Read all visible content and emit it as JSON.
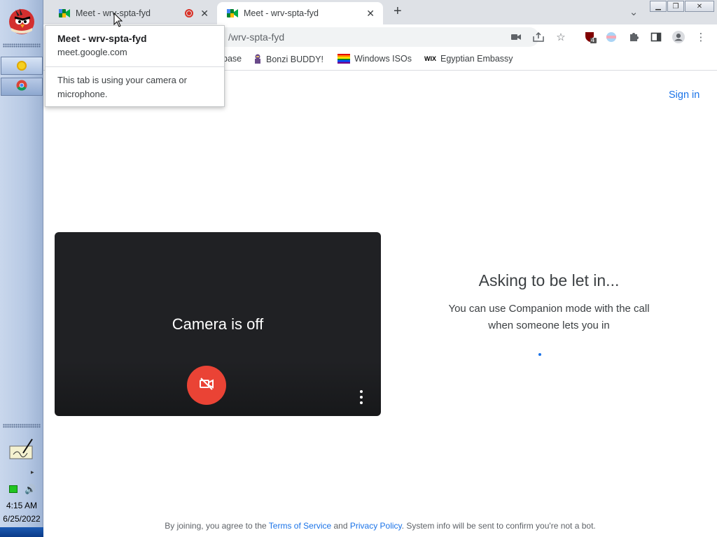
{
  "taskbar": {
    "time": "4:15 AM",
    "date": "6/25/2022"
  },
  "tabs": [
    {
      "title": "Meet - wrv-spta-fyd"
    },
    {
      "title": "Meet - wrv-spta-fyd"
    }
  ],
  "toolbar": {
    "url_visible": "/wrv-spta-fyd",
    "extension_badge": "4"
  },
  "bookmarks": [
    {
      "label": "base"
    },
    {
      "label": "Bonzi BUDDY!"
    },
    {
      "label": "Windows ISOs"
    },
    {
      "label": "Egyptian Embassy",
      "prefix": "WIX"
    }
  ],
  "tooltip": {
    "title": "Meet - wrv-spta-fyd",
    "domain": "meet.google.com",
    "message": "This tab is using your camera or microphone."
  },
  "page": {
    "sign_in": "Sign in",
    "camera_off": "Camera is off",
    "asking_title": "Asking to be let in...",
    "asking_subtitle": "You can use Companion mode with the call when someone lets you in",
    "footer_prefix": "By joining, you agree to the ",
    "footer_terms": "Terms of Service",
    "footer_and": " and ",
    "footer_privacy": "Privacy Policy",
    "footer_suffix": ". System info will be sent to confirm you're not a bot."
  },
  "colors": {
    "accent": "#1a73e8",
    "camera_button": "#ea4335",
    "video_bg": "#202124"
  }
}
